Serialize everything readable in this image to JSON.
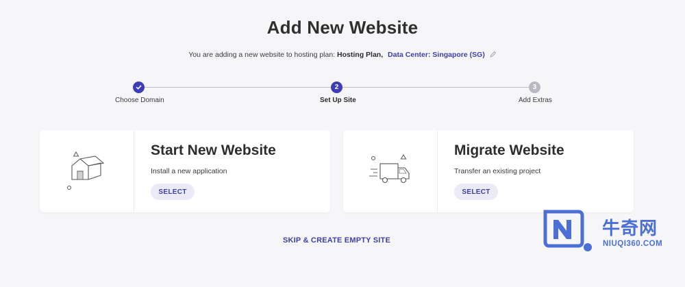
{
  "page": {
    "title": "Add New Website"
  },
  "subtitle": {
    "prefix": "You are adding a new website to hosting plan:",
    "plan": "Hosting Plan,",
    "datacenter": "Data Center: Singapore (SG)",
    "edit_icon": "pencil-icon"
  },
  "stepper": {
    "steps": [
      {
        "number": "✓",
        "label": "Choose Domain",
        "state": "done"
      },
      {
        "number": "2",
        "label": "Set Up Site",
        "state": "active"
      },
      {
        "number": "3",
        "label": "Add Extras",
        "state": "pending"
      }
    ]
  },
  "cards": {
    "start": {
      "title": "Start New Website",
      "description": "Install a new application",
      "button": "SELECT",
      "icon": "house-icon"
    },
    "migrate": {
      "title": "Migrate Website",
      "description": "Transfer an existing project",
      "button": "SELECT",
      "icon": "truck-icon"
    }
  },
  "skip": {
    "label": "SKIP & CREATE EMPTY SITE"
  },
  "watermark": {
    "cn": "牛奇网",
    "en": "NIUQI360.COM"
  },
  "colors": {
    "accent": "#3d3db7",
    "background": "#f6f6f9",
    "button_bg": "#ebebf8",
    "watermark": "#4b6fd4"
  }
}
